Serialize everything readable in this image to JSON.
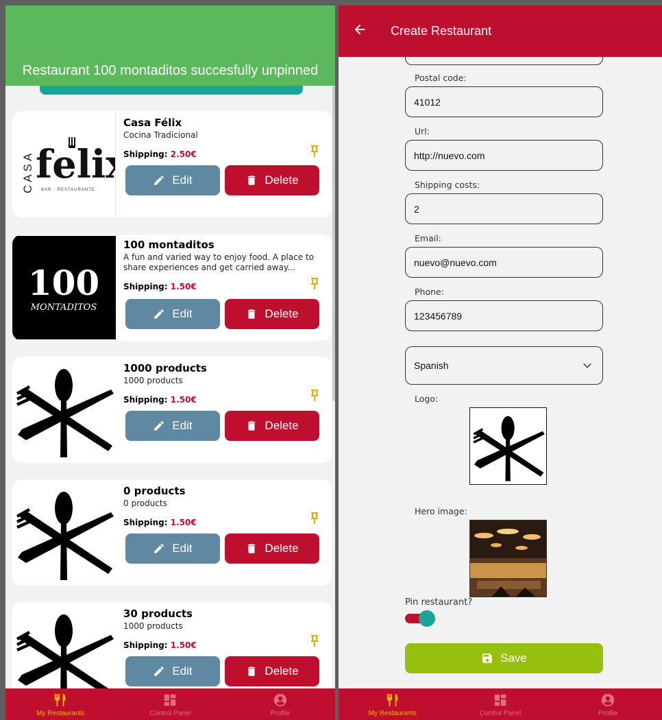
{
  "left": {
    "toast": "Restaurant 100 montaditos succesfully unpinned",
    "restaurants": [
      {
        "name": "Casa Félix",
        "description": "Cocina Tradicional",
        "shipping_label": "Shipping:",
        "shipping_price": "2.50€",
        "logo_text": "felix",
        "logo_vertical": "CASA",
        "logo_sub": "BAR · RESTAURANTE"
      },
      {
        "name": "100 montaditos",
        "description": "A fun and varied way to enjoy food. A place to share experiences and get carried away...",
        "shipping_label": "Shipping:",
        "shipping_price": "1.50€",
        "logo_text": "100",
        "logo_sub": "MONTADITOS"
      },
      {
        "name": "1000 products",
        "description": "1000 products",
        "shipping_label": "Shipping:",
        "shipping_price": "1.50€"
      },
      {
        "name": "0 products",
        "description": "0 products",
        "shipping_label": "Shipping:",
        "shipping_price": "1.50€"
      },
      {
        "name": "30 products",
        "description": "1000 products",
        "shipping_label": "Shipping:",
        "shipping_price": "1.50€"
      }
    ],
    "edit_label": "Edit",
    "delete_label": "Delete",
    "tabs": [
      "My Restaurants",
      "Control Panel",
      "Profile"
    ]
  },
  "right": {
    "title": "Create Restaurant",
    "fields": [
      {
        "label": "Postal code:",
        "value": "41012"
      },
      {
        "label": "Url:",
        "value": "http://nuevo.com"
      },
      {
        "label": "Shipping costs:",
        "value": "2"
      },
      {
        "label": "Email:",
        "value": "nuevo@nuevo.com"
      },
      {
        "label": "Phone:",
        "value": "123456789"
      }
    ],
    "category_select": "Spanish",
    "logo_label": "Logo:",
    "hero_label": "Hero image:",
    "pin_label": "Pin restaurant?",
    "pin_on": true,
    "save_label": "Save",
    "tabs": [
      "My Restaurants",
      "Control Panel",
      "Profile"
    ]
  },
  "colors": {
    "primary": "#be0f2e",
    "toast": "#5cb85c",
    "edit": "#5f88a2",
    "pin": "#f0a800",
    "accent": "#1aa59a",
    "save": "#97bf0d",
    "active_tab": "#f2b200"
  },
  "icons": {
    "edit": "pencil-icon",
    "delete": "trash-icon",
    "pin": "pin-icon",
    "back": "arrow-left-icon",
    "save": "floppy-icon",
    "select": "chevron-down-icon",
    "tabs": [
      "cutlery-icon",
      "dashboard-icon",
      "account-circle-icon"
    ]
  }
}
